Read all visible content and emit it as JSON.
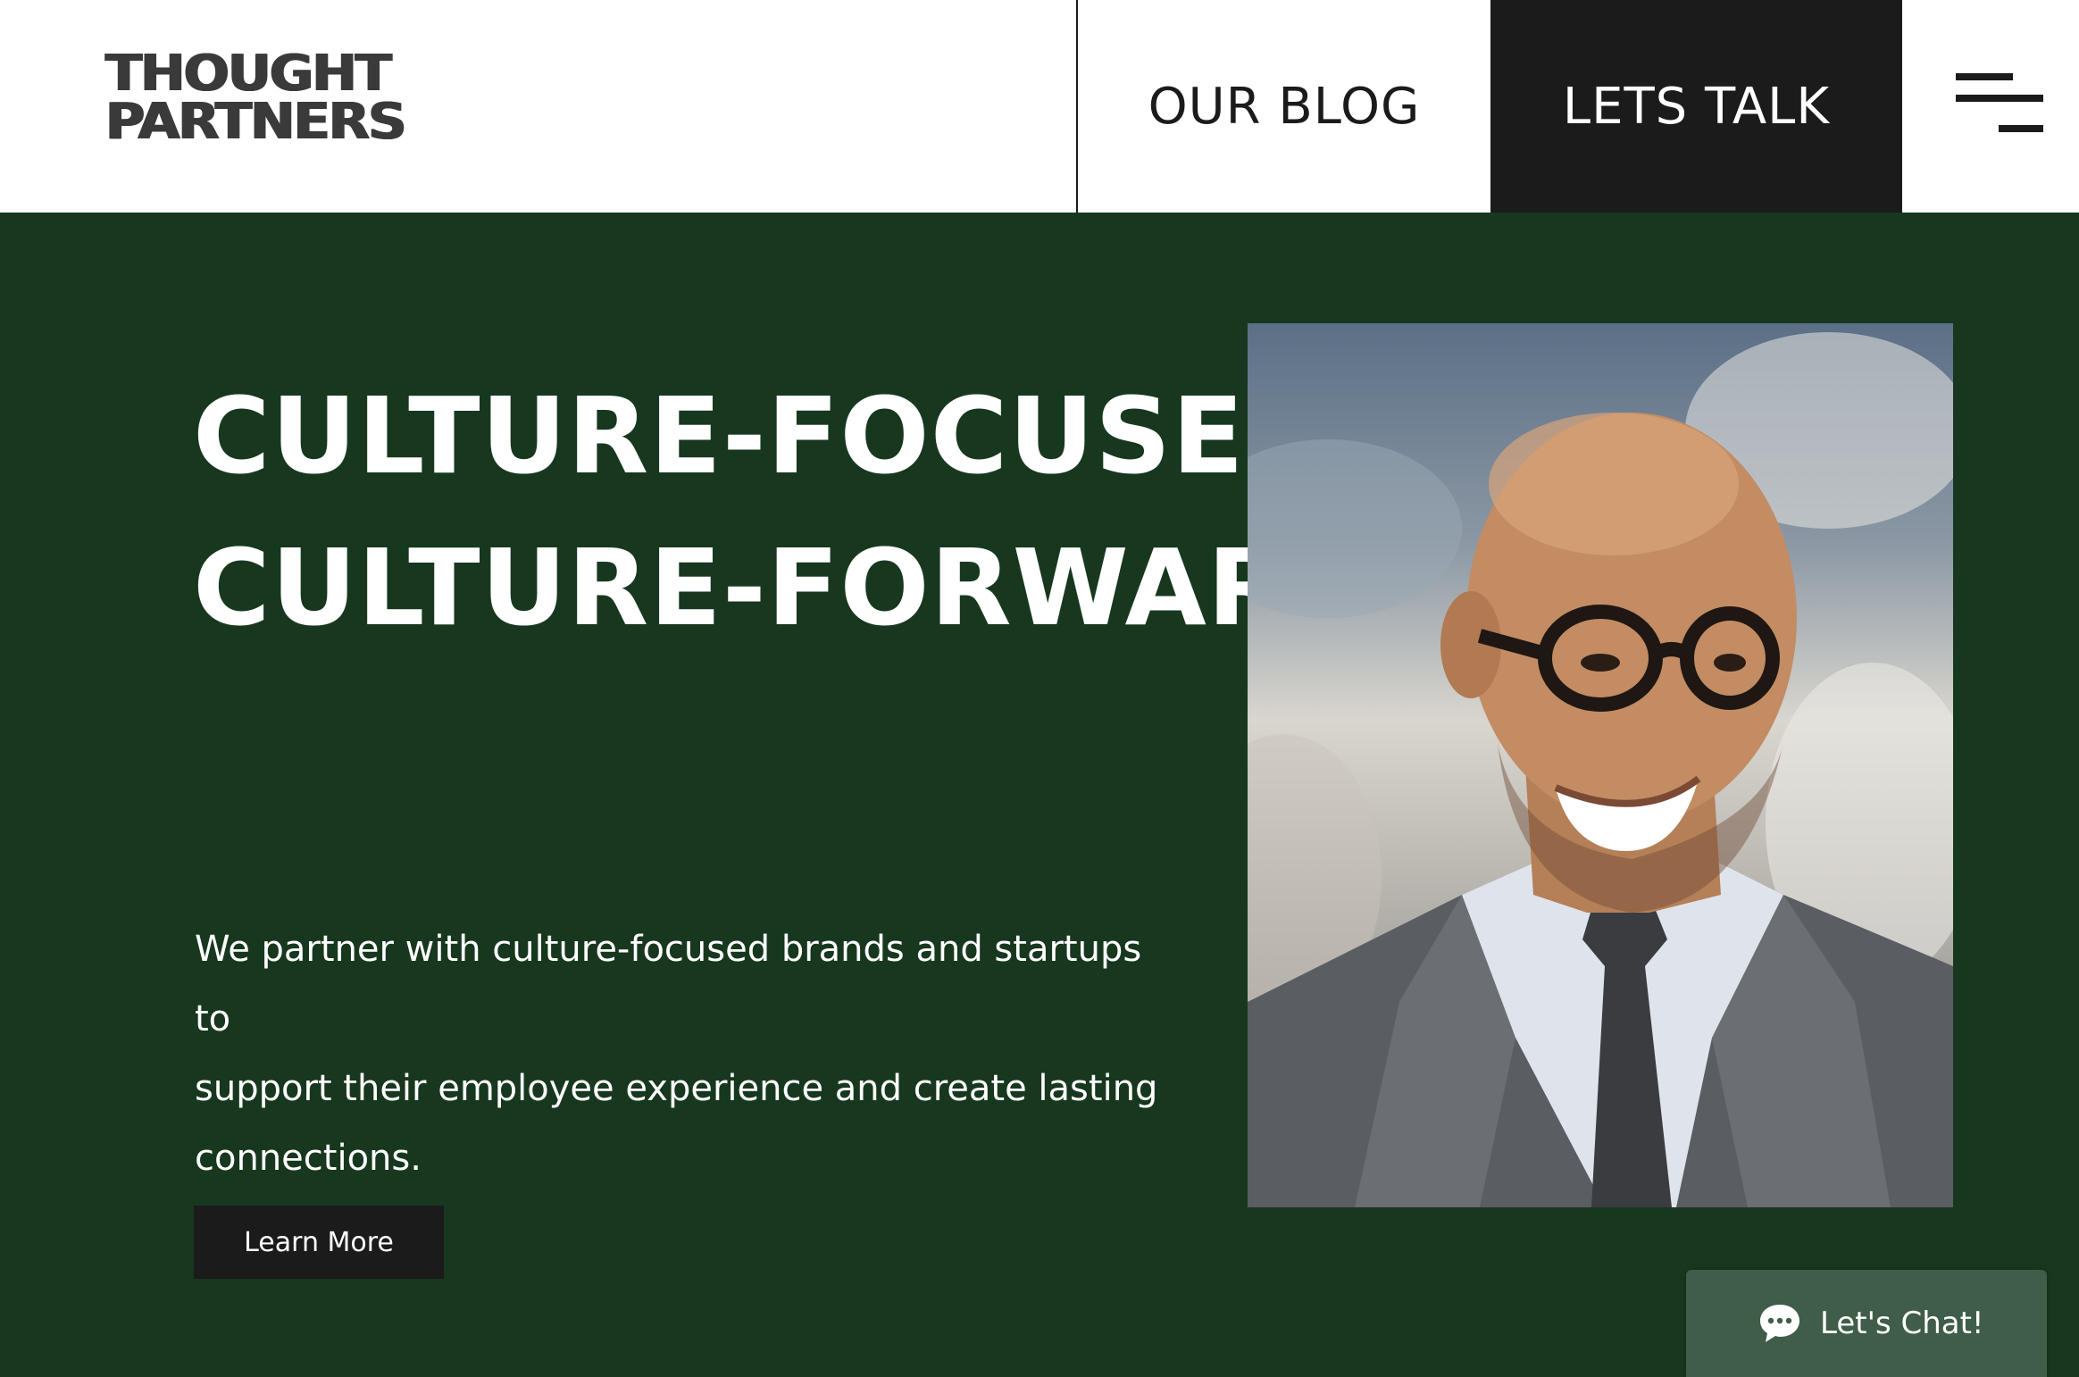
{
  "header": {
    "logo_line1": "THOUGHT",
    "logo_line2": "PARTNERS",
    "nav_blog": "OUR BLOG",
    "nav_talk": "LETS TALK",
    "menu_icon": "hamburger-menu-icon"
  },
  "hero": {
    "headline_line1": "CULTURE-FOCUSED.",
    "headline_line2": "CULTURE-FORWARD.",
    "subcopy_line1": "We partner with culture-focused brands and startups to",
    "subcopy_line2": "support their employee experience and create lasting",
    "subcopy_line3": "connections.",
    "cta_label": "Learn More"
  },
  "chat": {
    "label": "Let's Chat!",
    "icon": "chat-bubble-icon"
  },
  "colors": {
    "hero_bg": "#17381f",
    "dark": "#1b1b1b",
    "white": "#ffffff",
    "chat_bg": "#3f5d48",
    "logo": "#3a3a3a"
  }
}
